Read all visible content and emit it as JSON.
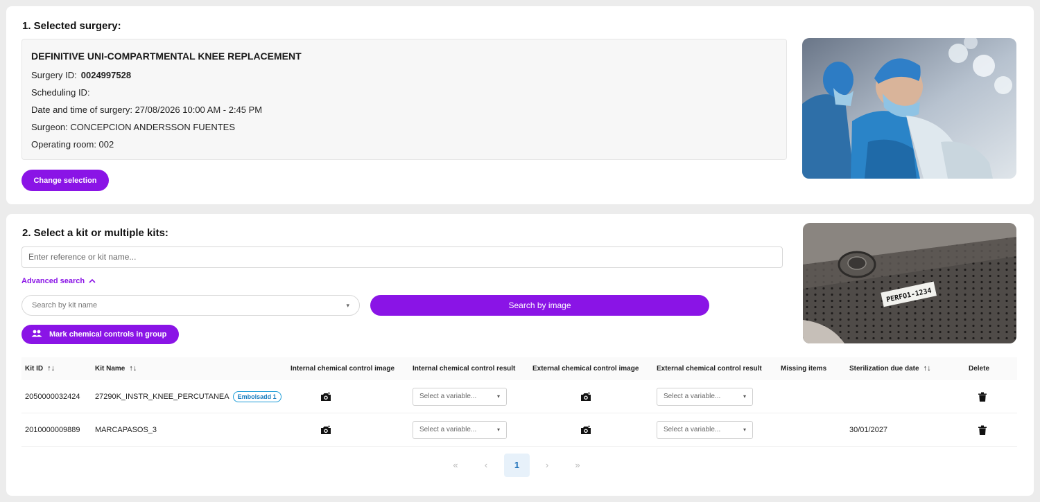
{
  "surgery_section": {
    "title": "1. Selected surgery:",
    "procedure_name": "DEFINITIVE UNI-COMPARTMENTAL KNEE REPLACEMENT",
    "surgery_id_label": "Surgery ID:",
    "surgery_id_value": "0024997528",
    "scheduling_id": "Scheduling ID:",
    "date_time": "Date and time of surgery: 27/08/2026 10:00 AM - 2:45 PM",
    "surgeon": "Surgeon: CONCEPCION ANDERSSON FUENTES",
    "operating_room": "Operating room: 002",
    "change_button": "Change selection"
  },
  "kits_section": {
    "title": "2. Select a kit or multiple kits:",
    "search_placeholder": "Enter reference or kit name...",
    "advanced_search": "Advanced search",
    "kit_name_placeholder": "Search by kit name",
    "search_by_image": "Search by image",
    "mark_group_button": "Mark chemical controls in group",
    "kit_image_label": "PERFO1-1234"
  },
  "table": {
    "columns": {
      "kit_id": "Kit ID",
      "kit_name": "Kit Name",
      "int_image": "Internal chemical control image",
      "int_result": "Internal chemical control result",
      "ext_image": "External chemical control image",
      "ext_result": "External chemical control result",
      "missing": "Missing items",
      "due_date": "Sterilization due date",
      "delete": "Delete"
    },
    "select_placeholder": "Select a variable...",
    "rows": [
      {
        "kit_id": "2050000032424",
        "kit_name": "27290K_INSTR_KNEE_PERCUTANEA",
        "badge": "Embolsadd 1",
        "missing": "",
        "due_date": ""
      },
      {
        "kit_id": "2010000009889",
        "kit_name": "MARCAPASOS_3",
        "badge": "",
        "missing": "",
        "due_date": "30/01/2027"
      }
    ]
  },
  "pagination": {
    "first": "«",
    "prev": "‹",
    "current": "1",
    "next": "›",
    "last": "»"
  },
  "colors": {
    "accent": "#8a14e6",
    "badge": "#1a9bd7",
    "page_active_bg": "#e7f1fa"
  },
  "icons": [
    "chevron-up-icon",
    "chevron-down-icon",
    "users-icon",
    "camera-icon",
    "trash-icon",
    "sort-icon"
  ]
}
